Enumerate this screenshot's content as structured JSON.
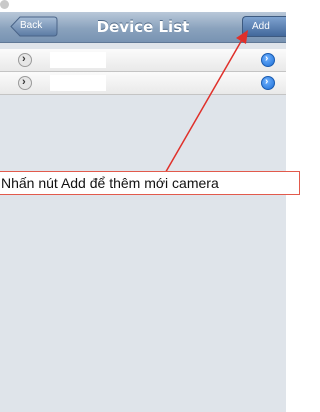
{
  "navbar": {
    "title": "Device List",
    "back_label": "Back",
    "add_label": "Add"
  },
  "devices": [
    {
      "name": ""
    },
    {
      "name": ""
    }
  ],
  "annotation": {
    "text": "Nhấn nút Add để thêm mới camera",
    "color": "#e0302a"
  }
}
